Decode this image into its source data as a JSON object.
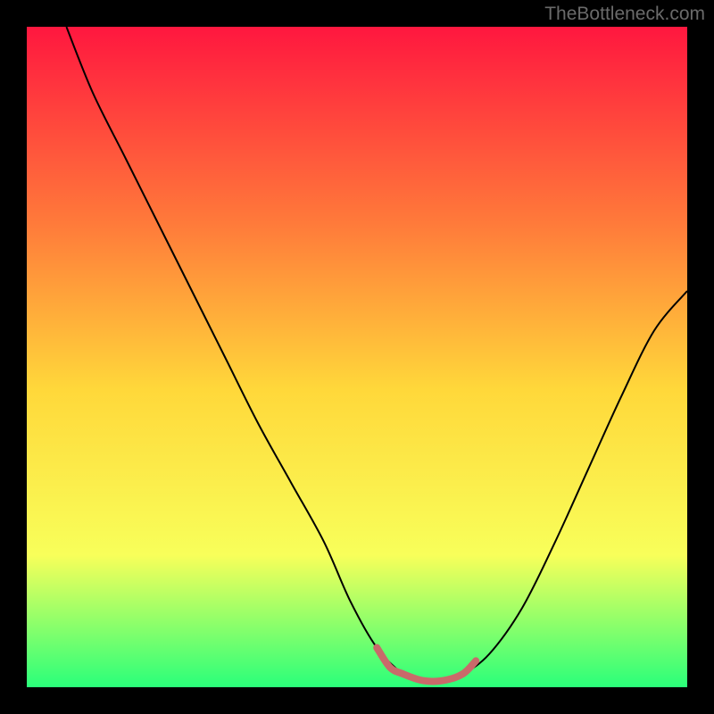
{
  "watermark": "TheBottleneck.com",
  "chart_data": {
    "type": "line",
    "title": "",
    "xlabel": "",
    "ylabel": "",
    "xlim": [
      0,
      100
    ],
    "ylim": [
      0,
      100
    ],
    "background_gradient": {
      "top": "#ff173f",
      "upper_mid": "#ff7b3a",
      "mid": "#ffd83a",
      "lower_mid": "#f8ff5a",
      "bottom": "#2aff7a"
    },
    "series": [
      {
        "name": "main-curve",
        "x": [
          6,
          10,
          15,
          20,
          25,
          30,
          35,
          40,
          45,
          49,
          53,
          57,
          60,
          63,
          66,
          70,
          75,
          80,
          85,
          90,
          95,
          100
        ],
        "y": [
          100,
          90,
          80,
          70,
          60,
          50,
          40,
          31,
          22,
          13,
          6,
          2,
          1,
          1,
          2,
          5,
          12,
          22,
          33,
          44,
          54,
          60
        ],
        "color": "#000000",
        "width": 2
      },
      {
        "name": "trough-highlight",
        "x": [
          53,
          55,
          57,
          60,
          63,
          66,
          68
        ],
        "y": [
          6,
          3,
          2,
          1,
          1,
          2,
          4
        ],
        "color": "#c96a6a",
        "width": 8
      }
    ]
  }
}
